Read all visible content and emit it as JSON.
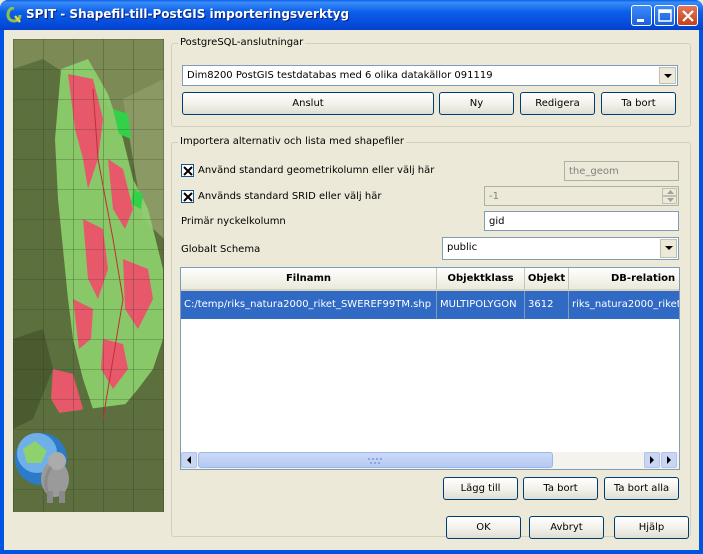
{
  "window": {
    "title": "SPIT - Shapefil-till-PostGIS importeringsverktyg"
  },
  "connections": {
    "group_title": "PostgreSQL-anslutningar",
    "selected": "Dim8200 PostGIS testdatabas med 6 olika datakällor 091119",
    "buttons": {
      "connect": "Anslut",
      "new": "Ny",
      "edit": "Redigera",
      "delete": "Ta bort"
    }
  },
  "import": {
    "group_title": "Importera alternativ och lista med shapefiler",
    "geom_checkbox_label": "Använd standard geometrikolumn eller välj här",
    "geom_checked": true,
    "geom_value": "the_geom",
    "srid_checkbox_label": "Används standard SRID eller välj här",
    "srid_checked": true,
    "srid_value": "-1",
    "pk_label": "Primär nyckelkolumn",
    "pk_value": "gid",
    "schema_label": "Globalt Schema",
    "schema_value": "public"
  },
  "table": {
    "columns": [
      "Filnamn",
      "Objektklass",
      "Objekt",
      "DB-relation"
    ],
    "rows": [
      [
        "C:/temp/riks_natura2000_riket_SWEREF99TM.shp",
        "MULTIPOLYGON",
        "3612",
        "riks_natura2000_riket"
      ]
    ]
  },
  "list_buttons": {
    "add": "Lägg till",
    "remove": "Ta bort",
    "remove_all": "Ta bort alla"
  },
  "dialog_buttons": {
    "ok": "OK",
    "cancel": "Avbryt",
    "help": "Hjälp"
  },
  "colors": {
    "titlebar": "#0054E3",
    "selection": "#316AC5",
    "map_protected": "#E8586B",
    "map_green": "#8ED26E"
  }
}
